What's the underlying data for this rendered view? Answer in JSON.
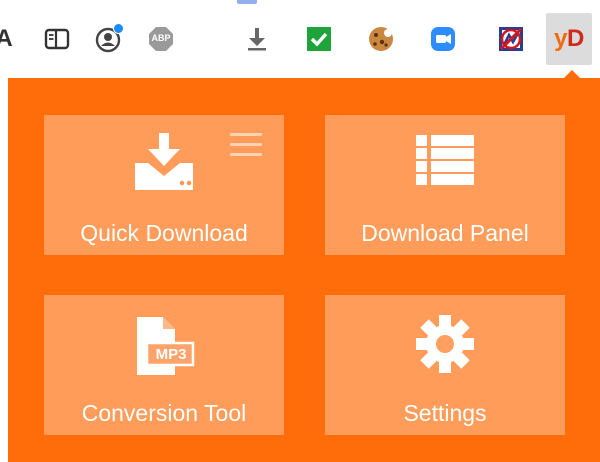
{
  "toolbar": {
    "icons": [
      {
        "name": "partial-a-icon",
        "glyph": "A"
      },
      {
        "name": "reading-list-icon"
      },
      {
        "name": "profile-icon"
      },
      {
        "name": "adblock-plus-icon",
        "text": "ABP"
      },
      {
        "name": "download-arrow-icon"
      },
      {
        "name": "green-check-icon"
      },
      {
        "name": "cookie-icon"
      },
      {
        "name": "zoom-video-icon"
      },
      {
        "name": "blocked-extension-icon"
      }
    ],
    "extension": {
      "y": "y",
      "d": "D",
      "name": "yd-extension-icon"
    }
  },
  "popup": {
    "tiles": [
      {
        "label": "Quick Download",
        "icon": "download-tray-icon"
      },
      {
        "label": "Download Panel",
        "icon": "list-panel-icon"
      },
      {
        "label": "Conversion Tool",
        "icon": "mp3-file-icon",
        "icon_text": "MP3"
      },
      {
        "label": "Settings",
        "icon": "gear-icon"
      }
    ],
    "quick_menu_icon": "hamburger-menu-icon"
  },
  "colors": {
    "popup_bg": "#ff6d0b",
    "tile_bg": "rgba(255,255,255,0.32)",
    "accent_blue": "#1a8cff",
    "yd_orange": "#f26a10",
    "yd_red": "#d02a1c"
  }
}
